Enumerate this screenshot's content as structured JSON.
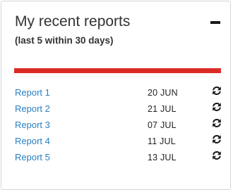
{
  "widget": {
    "title": "My recent reports",
    "subtitle": "(last 5 within 30 days)",
    "accent_color": "#db2b26",
    "link_color": "#2a7fc0",
    "collapse_icon": "minus-icon",
    "refresh_icon": "refresh-icon"
  },
  "reports": [
    {
      "name": "Report 1",
      "date": "20 JUN"
    },
    {
      "name": "Report 2",
      "date": "21 JUL"
    },
    {
      "name": "Report 3",
      "date": "07 JUL"
    },
    {
      "name": "Report 4",
      "date": "11 JUL"
    },
    {
      "name": "Report 5",
      "date": "13 JUL"
    }
  ]
}
